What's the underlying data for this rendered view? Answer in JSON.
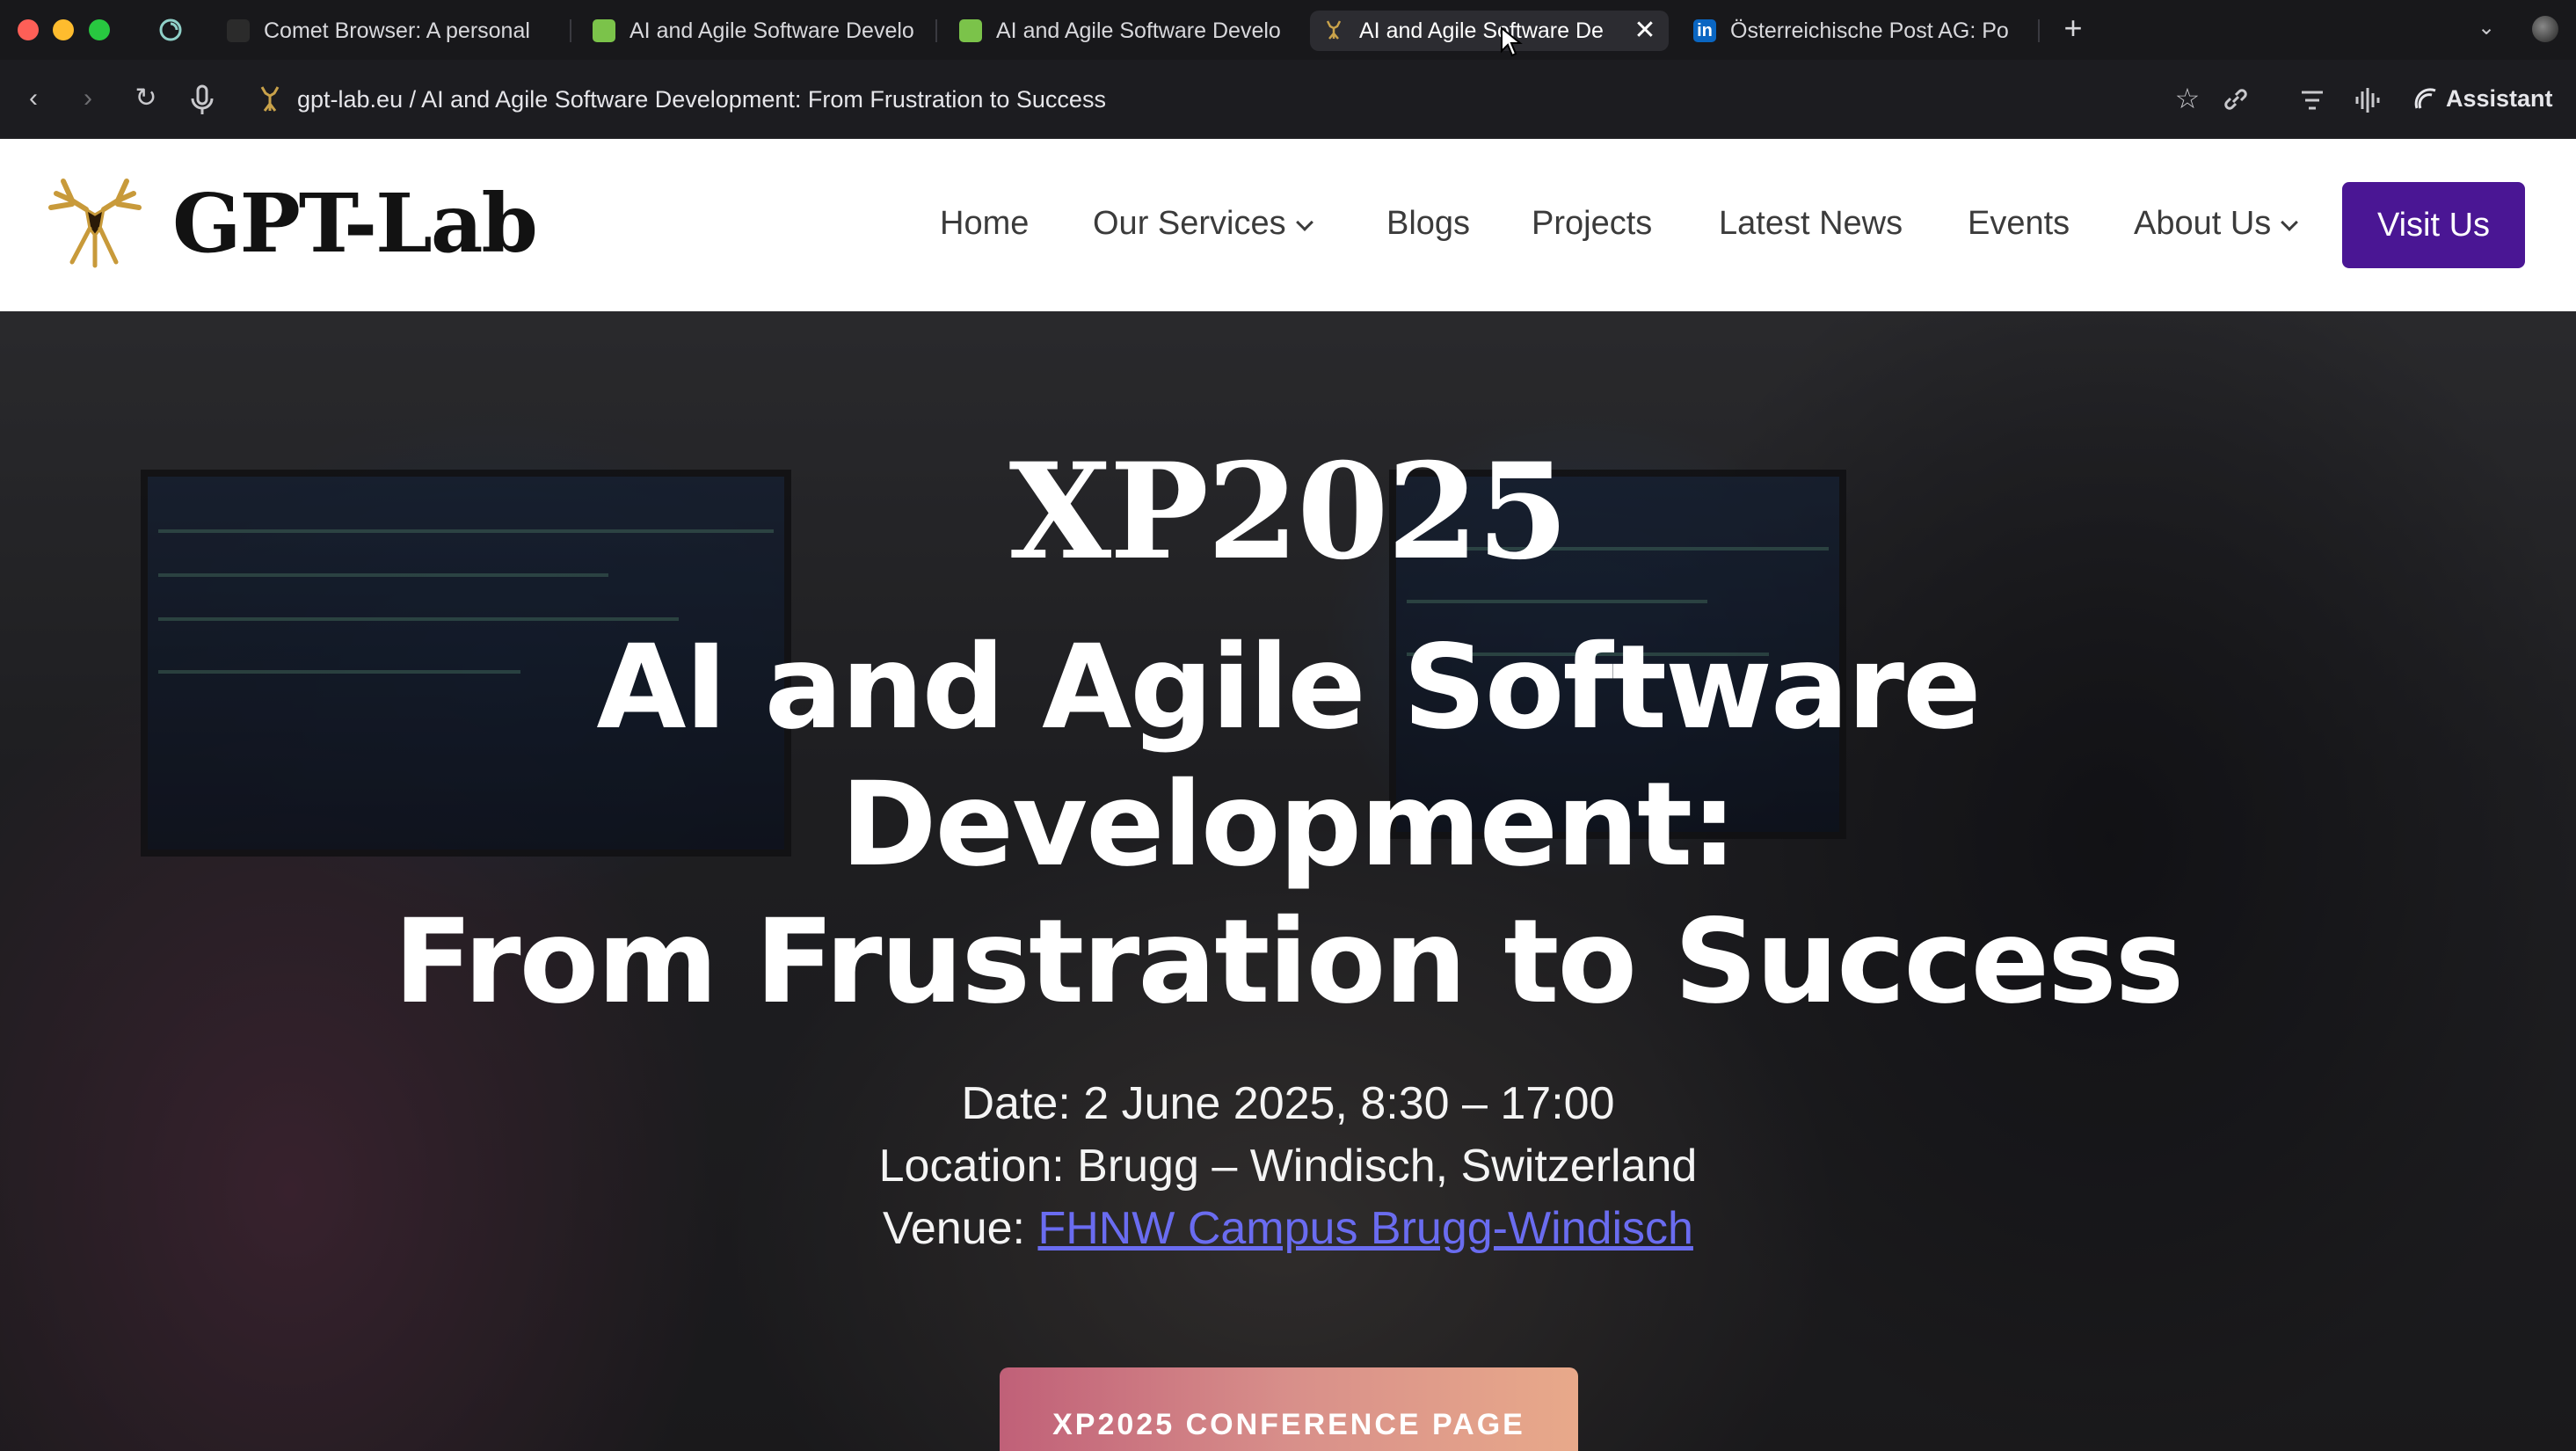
{
  "browser": {
    "tabs": [
      {
        "title": "Comet Browser: A personal",
        "favicon": "comet-icon",
        "active": false
      },
      {
        "title": "AI and Agile Software Develo",
        "favicon": "smiley-icon",
        "active": false
      },
      {
        "title": "AI and Agile Software Develo",
        "favicon": "smiley-icon",
        "active": false
      },
      {
        "title": "AI and Agile Software De",
        "favicon": "deer-icon",
        "active": true
      },
      {
        "title": "Österreichische Post AG: Po",
        "favicon": "linkedin-icon",
        "active": false
      }
    ],
    "linkedin_letters": "in",
    "address": "gpt-lab.eu / AI and Agile Software Development: From Frustration to Success",
    "assistant_label": "Assistant",
    "new_tab_symbol": "+",
    "close_symbol": "✕"
  },
  "site": {
    "logo_text": "GPT-Lab",
    "nav": {
      "home": "Home",
      "services": "Our Services",
      "blogs": "Blogs",
      "projects": "Projects",
      "news": "Latest News",
      "events": "Events",
      "about": "About Us"
    },
    "visit_button": "Visit Us"
  },
  "hero": {
    "event_name": "XP2025",
    "title_line1": "AI and Agile Software",
    "title_line2": "Development:",
    "title_line3": "From Frustration to Success",
    "date": "Date: 2 June 2025, 8:30 – 17:00",
    "location": "Location: Brugg – Windisch, Switzerland",
    "venue_label": "Venue: ",
    "venue_link": "FHNW Campus Brugg-Windisch",
    "cta": "XP2025 CONFERENCE PAGE"
  },
  "colors": {
    "brand_purple": "#4a1694",
    "link_blue": "#6a6cf0",
    "cta_gradient_start": "#c06078",
    "cta_gradient_end": "#e8a98a"
  }
}
